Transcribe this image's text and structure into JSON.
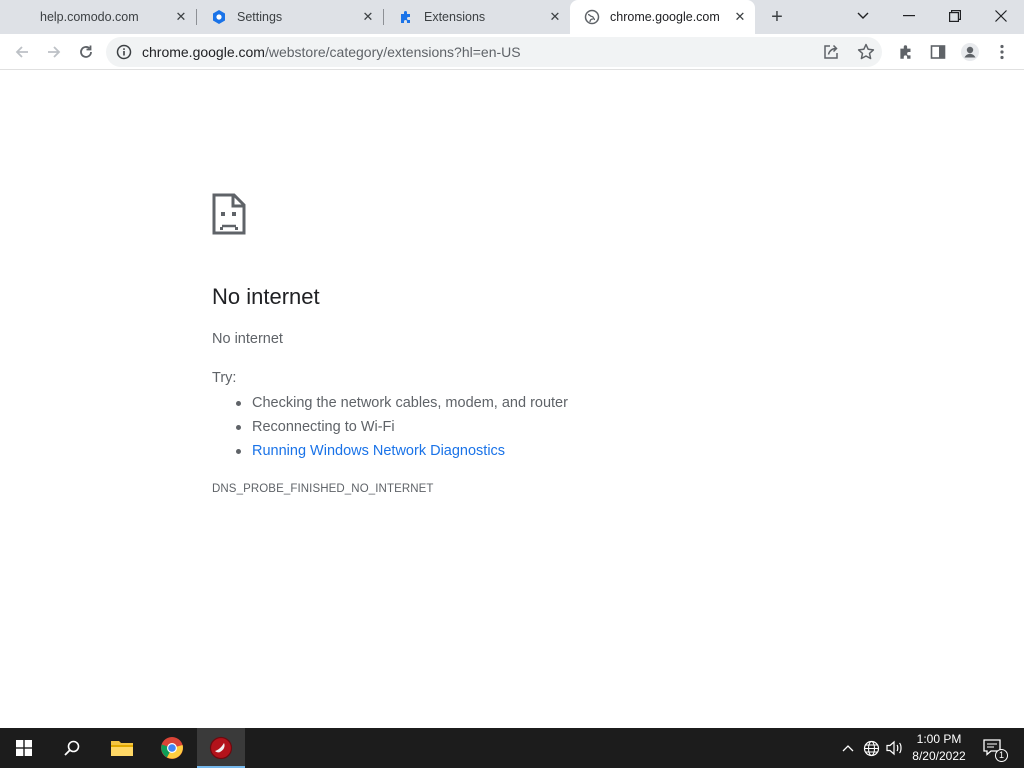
{
  "browser": {
    "tabs": [
      {
        "title": "help.comodo.com",
        "favicon": "globe-icon",
        "active": false
      },
      {
        "title": "Settings",
        "favicon": "gear-icon",
        "active": false
      },
      {
        "title": "Extensions",
        "favicon": "puzzle-icon",
        "active": false
      },
      {
        "title": "chrome.google.com",
        "favicon": "globe-icon",
        "active": true
      }
    ],
    "new_tab_label": "+",
    "url_host": "chrome.google.com",
    "url_path": "/webstore/category/extensions?hl=en-US"
  },
  "error_page": {
    "heading": "No internet",
    "subheading": "No internet",
    "try_label": "Try:",
    "suggestions": [
      "Checking the network cables, modem, and router",
      "Reconnecting to Wi-Fi",
      "Running Windows Network Diagnostics"
    ],
    "error_code": "DNS_PROBE_FINISHED_NO_INTERNET"
  },
  "taskbar": {
    "time": "1:00 PM",
    "date": "8/20/2022",
    "notification_count": "1"
  },
  "colors": {
    "link": "#1a73e8",
    "tabstrip": "#dee1e6",
    "taskbar": "#1c1c1c"
  }
}
